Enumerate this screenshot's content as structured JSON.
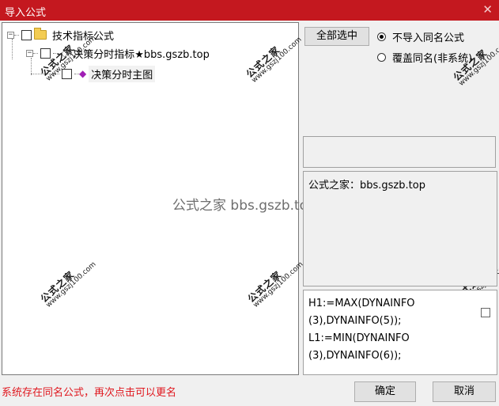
{
  "window": {
    "title": "导入公式",
    "close_glyph": "✕"
  },
  "tree": {
    "root": {
      "expander": "−",
      "label": "技术指标公式"
    },
    "child": {
      "expander": "−",
      "label": "决策分时指标★bbs.gszb.top"
    },
    "leaf": {
      "label": "决策分时主图"
    }
  },
  "buttons": {
    "select_all": "全部选中",
    "ok": "确定",
    "cancel": "取消"
  },
  "options": {
    "selected": "no_import",
    "items": [
      {
        "id": "no_import",
        "label": "不导入同名公式"
      },
      {
        "id": "overwrite",
        "label": "覆盖同名(非系统)"
      }
    ]
  },
  "description": "公式之家：bbs.gszb.top",
  "formula": {
    "lines": [
      "H1:=MAX(DYNAINFO",
      "(3),DYNAINFO(5));",
      "L1:=MIN(DYNAINFO",
      "(3),DYNAINFO(6));"
    ]
  },
  "status_message": "系统存在同名公式，再次点击可以更名",
  "watermark": {
    "center": "公式之家 bbs.gszb.top",
    "stamp_title": "公式之家",
    "stamp_url": "www.gszj100.com"
  }
}
